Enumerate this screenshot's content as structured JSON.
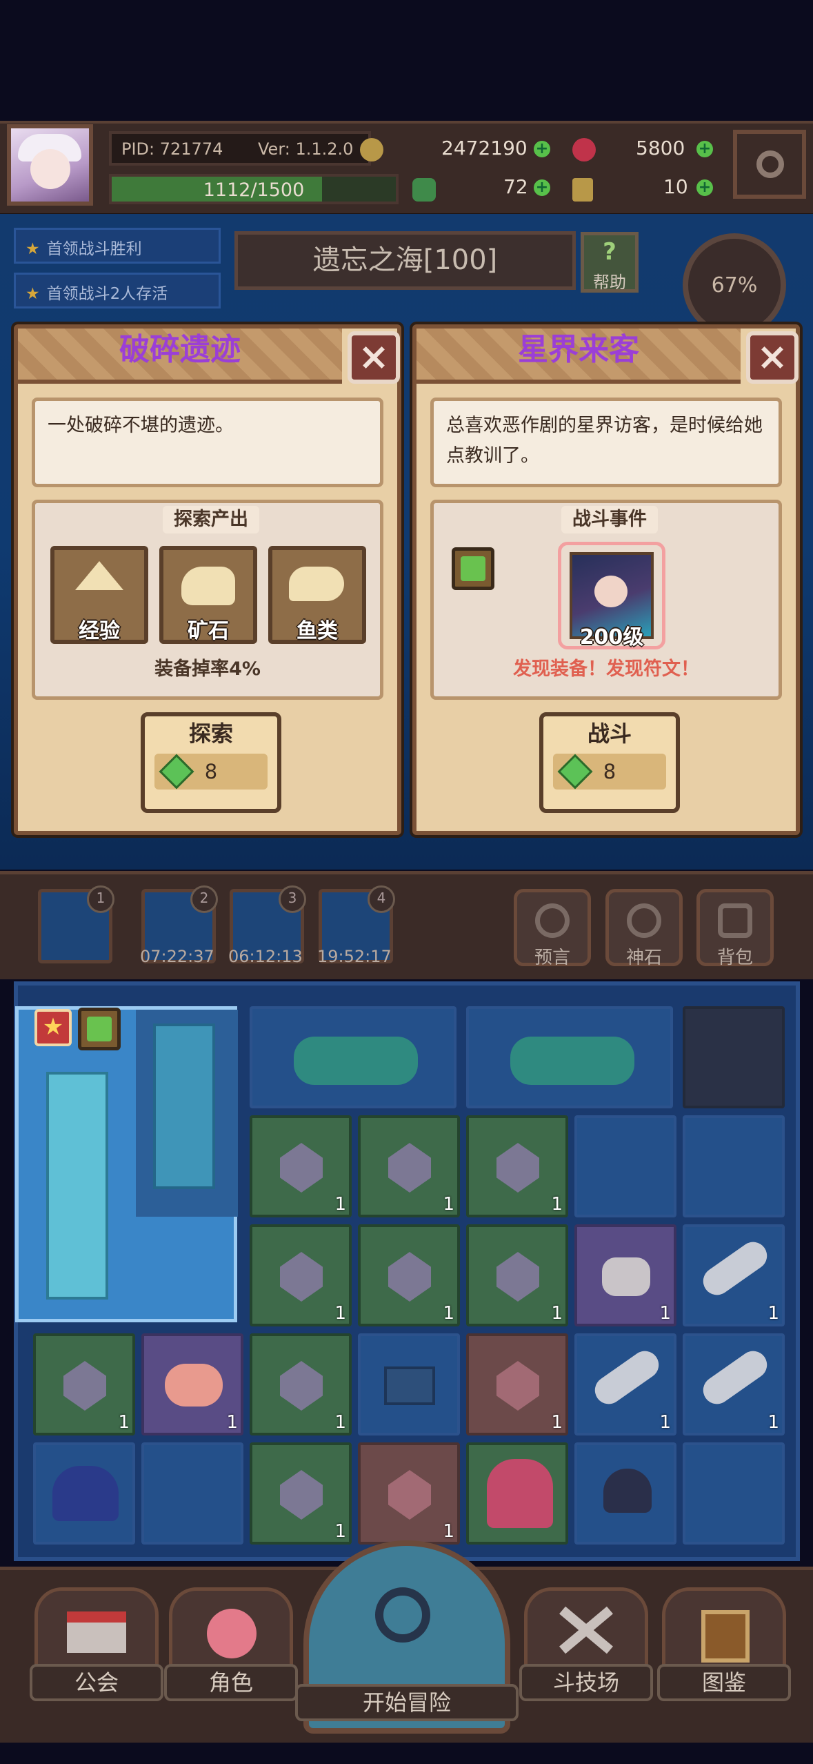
{
  "player": {
    "pid": "PID: 721774",
    "version": "Ver: 1.1.2.0",
    "gold": "2472190",
    "ruby": "5800",
    "exp_bar": "1112/1500",
    "clover": "72",
    "key": "10"
  },
  "quests": [
    "首领战斗胜利",
    "首领战斗2人存活"
  ],
  "location": {
    "name": "遗忘之海[100]",
    "help_label": "帮助",
    "progress": "67%"
  },
  "left_panel": {
    "title": "破碎遗迹",
    "description": "一处破碎不堪的遗迹。",
    "section_label": "探索产出",
    "outputs": [
      "经验",
      "矿石",
      "鱼类"
    ],
    "drop_rate": "装备掉率4%",
    "button_label": "探索",
    "cost": "8"
  },
  "right_panel": {
    "title": "星界来客",
    "description": "总喜欢恶作剧的星界访客，是时候给她点教训了。",
    "section_label": "战斗事件",
    "enemy_level": "200级",
    "notice": "发现装备！发现符文！",
    "button_label": "战斗",
    "cost": "8"
  },
  "slots": {
    "numbers": [
      "1",
      "2",
      "3",
      "4"
    ],
    "timers": [
      "07:22:37",
      "06:12:13",
      "19:52:17"
    ]
  },
  "tools": [
    "预言",
    "神石",
    "背包"
  ],
  "nav": [
    "公会",
    "角色",
    "开始冒险",
    "斗技场",
    "图鉴"
  ],
  "inventory_count": "1",
  "colors": {
    "panel_bg": "#e8cfa6",
    "title_text": "#9b3fd6",
    "notice": "#e06050",
    "close": "#7d3b34"
  }
}
